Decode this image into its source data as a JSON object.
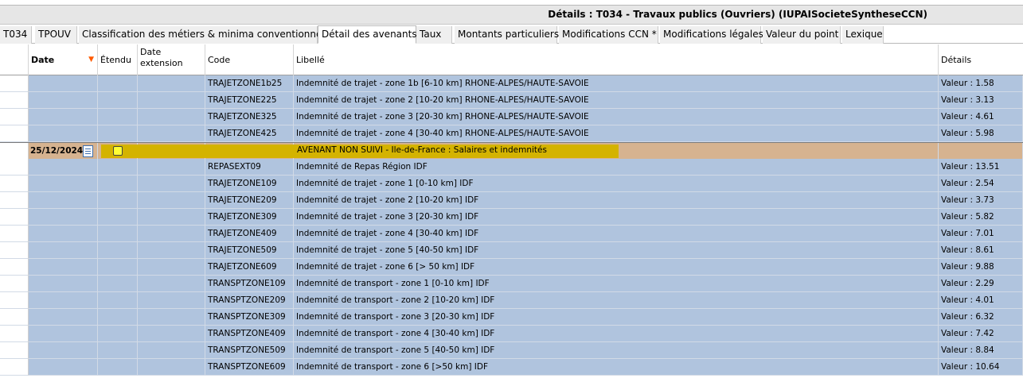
{
  "window": {
    "title": "Détails : T034 - Travaux publics (Ouvriers) (IUPAISocieteSyntheseCCN)"
  },
  "tabs": [
    {
      "label": "T034"
    },
    {
      "label": "TPOUV"
    },
    {
      "label": "Classification des métiers & minima conventionnels"
    },
    {
      "label": "Détail des avenants",
      "active": true
    },
    {
      "label": "Taux"
    },
    {
      "label": "Montants particuliers"
    },
    {
      "label": "Modifications CCN *"
    },
    {
      "label": "Modifications légales"
    },
    {
      "label": "Valeur du point"
    },
    {
      "label": "Lexique"
    }
  ],
  "columns": {
    "date": "Date",
    "etendu": "Étendu",
    "date_extension": "Date extension",
    "code": "Code",
    "libelle": "Libellé",
    "details": "Détails"
  },
  "rows_before": [
    {
      "code": "TRAJETZONE1b25",
      "libelle": "Indemnité de trajet - zone 1b [6-10 km] RHONE-ALPES/HAUTE-SAVOIE",
      "details": "Valeur : 1.58"
    },
    {
      "code": "TRAJETZONE225",
      "libelle": "Indemnité de trajet - zone 2 [10-20 km] RHONE-ALPES/HAUTE-SAVOIE",
      "details": "Valeur : 3.13"
    },
    {
      "code": "TRAJETZONE325",
      "libelle": "Indemnité de trajet - zone 3 [20-30 km] RHONE-ALPES/HAUTE-SAVOIE",
      "details": "Valeur : 4.61"
    },
    {
      "code": "TRAJETZONE425",
      "libelle": "Indemnité de trajet - zone 4 [30-40 km] RHONE-ALPES/HAUTE-SAVOIE",
      "details": "Valeur : 5.98"
    }
  ],
  "avenant": {
    "date": "25/12/2024",
    "libelle": "AVENANT NON SUIVI - Ile-de-France : Salaires et indemnités",
    "colors": {
      "bar": "#d4b300",
      "row": "#d6b390"
    }
  },
  "rows_after": [
    {
      "code": "REPASEXT09",
      "libelle": "Indemnité de Repas Région IDF",
      "details": "Valeur : 13.51"
    },
    {
      "code": "TRAJETZONE109",
      "libelle": "Indemnité de trajet - zone 1 [0-10 km] IDF",
      "details": "Valeur : 2.54"
    },
    {
      "code": "TRAJETZONE209",
      "libelle": "Indemnité de trajet - zone 2 [10-20 km] IDF",
      "details": "Valeur : 3.73"
    },
    {
      "code": "TRAJETZONE309",
      "libelle": "Indemnité de trajet - zone 3 [20-30 km] IDF",
      "details": "Valeur : 5.82"
    },
    {
      "code": "TRAJETZONE409",
      "libelle": "Indemnité de trajet - zone 4 [30-40 km] IDF",
      "details": "Valeur : 7.01"
    },
    {
      "code": "TRAJETZONE509",
      "libelle": "Indemnité de trajet - zone 5 [40-50 km] IDF",
      "details": "Valeur : 8.61"
    },
    {
      "code": "TRAJETZONE609",
      "libelle": "Indemnité de trajet - zone 6 [> 50 km] IDF",
      "details": "Valeur : 9.88"
    },
    {
      "code": "TRANSPTZONE109",
      "libelle": "Indemnité de transport - zone 1 [0-10 km] IDF",
      "details": "Valeur : 2.29"
    },
    {
      "code": "TRANSPTZONE209",
      "libelle": "Indemnité de transport - zone 2 [10-20 km] IDF",
      "details": "Valeur : 4.01"
    },
    {
      "code": "TRANSPTZONE309",
      "libelle": "Indemnité de transport - zone 3 [20-30 km] IDF",
      "details": "Valeur : 6.32"
    },
    {
      "code": "TRANSPTZONE409",
      "libelle": "Indemnité de transport - zone 4 [30-40 km] IDF",
      "details": "Valeur : 7.42"
    },
    {
      "code": "TRANSPTZONE509",
      "libelle": "Indemnité de transport - zone 5 [40-50 km] IDF",
      "details": "Valeur : 8.84"
    },
    {
      "code": "TRANSPTZONE609",
      "libelle": "Indemnité de transport - zone 6 [>50 km] IDF",
      "details": "Valeur : 10.64"
    }
  ],
  "icons": {
    "sort": "sort-desc-icon",
    "document": "document-icon",
    "checkbox": "checkbox-icon"
  },
  "colors": {
    "row_bg": "#b0c4de",
    "sort_arrow": "#ff5a00"
  }
}
